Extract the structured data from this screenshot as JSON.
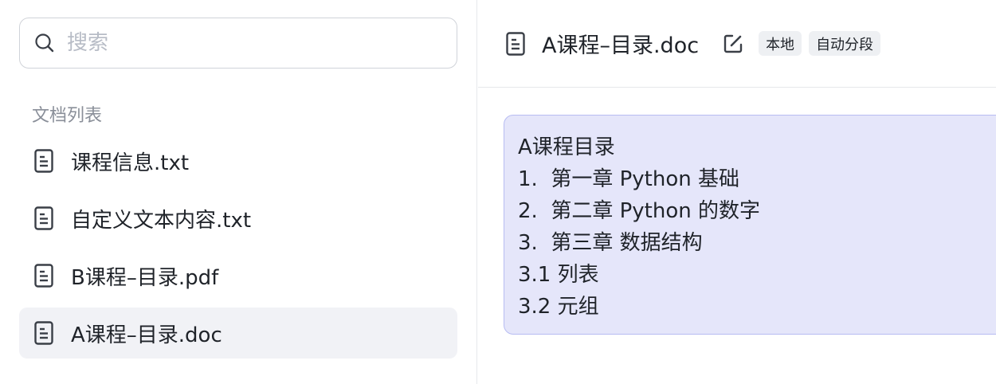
{
  "search": {
    "placeholder": "搜索"
  },
  "sidebar": {
    "section_label": "文档列表",
    "items": [
      {
        "label": "课程信息.txt"
      },
      {
        "label": "自定义文本内容.txt"
      },
      {
        "label": "B课程–目录.pdf"
      },
      {
        "label": "A课程–目录.doc"
      }
    ]
  },
  "header": {
    "title": "A课程–目录.doc",
    "tags": [
      "本地",
      "自动分段"
    ]
  },
  "content": {
    "lines": [
      "A课程目录",
      "1.  第一章 Python 基础",
      "2.  第二章 Python 的数字",
      "3.  第三章 数据结构",
      "3.1 列表",
      "3.2 元组"
    ]
  },
  "colors": {
    "active_item_bg": "#f1f2f6",
    "content_bg": "#e5e6fa",
    "content_border": "#b7bcf2",
    "tag_bg": "#eef0f3"
  }
}
